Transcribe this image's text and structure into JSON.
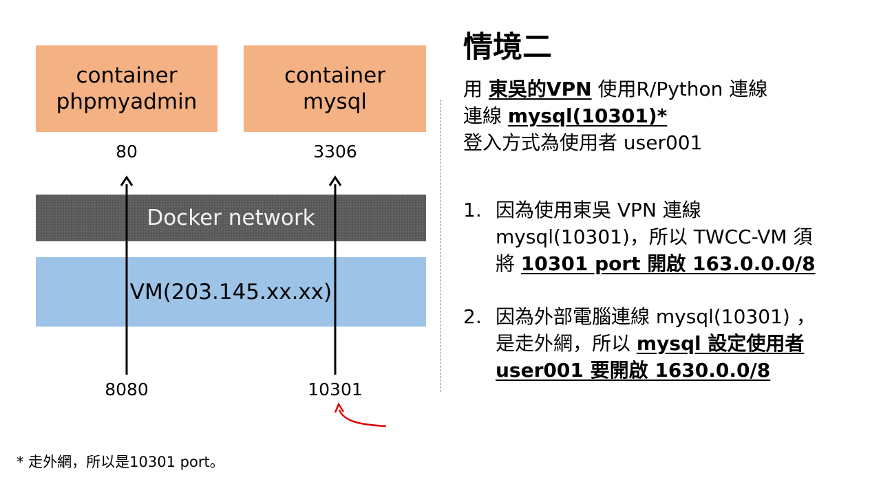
{
  "diagram": {
    "containers": {
      "phpmyadmin": {
        "line1": "container",
        "line2": "phpmyadmin"
      },
      "mysql": {
        "line1": "container",
        "line2": "mysql"
      }
    },
    "docker_network": "Docker network",
    "vm": "VM(203.145.xx.xx)",
    "ports": {
      "inner_left": "80",
      "inner_right": "3306",
      "outer_left": "8080",
      "outer_right": "10301"
    },
    "colors": {
      "container": "#f4b183",
      "docker": "#595959",
      "vm": "#9dc3e6",
      "highlight_arrow": "#e00000"
    }
  },
  "panel": {
    "heading": "情境二",
    "intro": {
      "l1_prefix": "用 ",
      "l1_bold": "東吳的VPN",
      "l1_suffix": " 使用R/Python 連線",
      "l2_prefix": "連線 ",
      "l2_bold": "mysql(10301)*",
      "l3": "登入方式為使用者 user001"
    },
    "item1": {
      "num": "1.",
      "line1": "因為使用東吳 VPN 連線",
      "line2": "mysql(10301)，所以 TWCC-VM 須",
      "line3_prefix": "將 ",
      "line3_bold": "10301 port 開啟 163.0.0.0/8"
    },
    "item2": {
      "num": "2.",
      "line1": "因為外部電腦連線 mysql(10301) ，",
      "line2_prefix": "是走外網，所以 ",
      "line2_bold": "mysql 設定使用者",
      "line3_bold": "user001 要開啟 1630.0.0/8"
    }
  },
  "footnote": "* 走外網，所以是10301 port。"
}
